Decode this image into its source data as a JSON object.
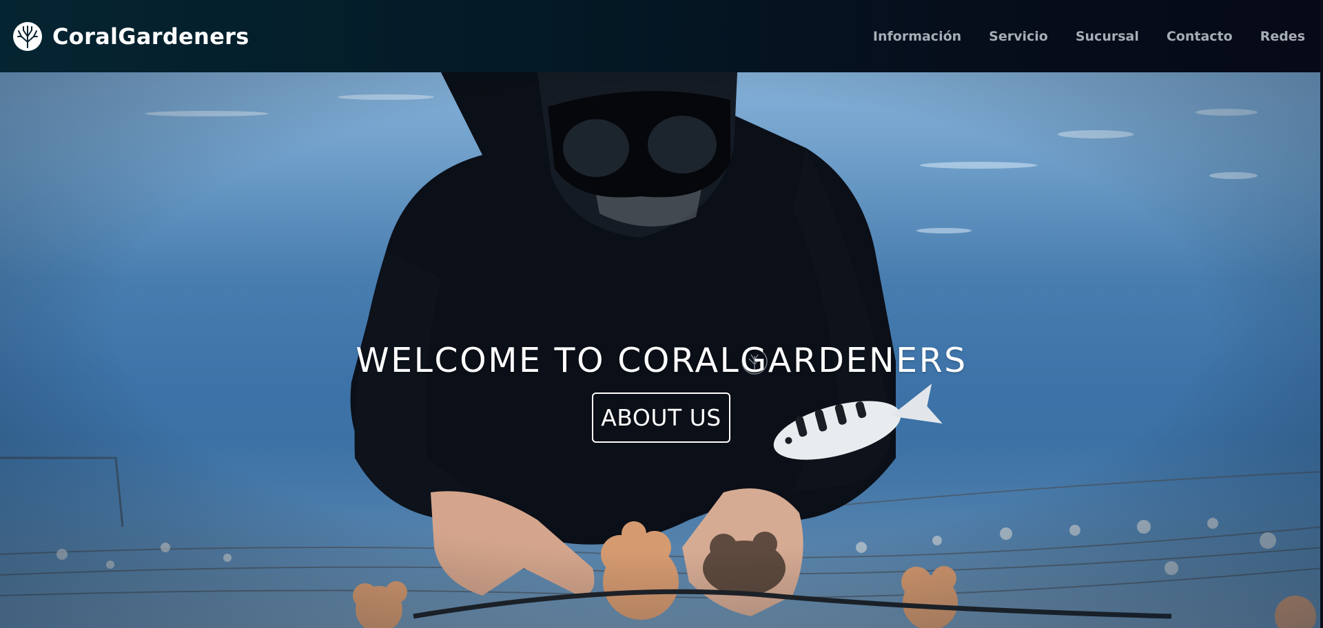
{
  "brand": {
    "name": "CoralGardeners",
    "logo_icon": "coral-icon"
  },
  "nav": {
    "items": [
      {
        "label": "Información"
      },
      {
        "label": "Servicio"
      },
      {
        "label": "Sucursal"
      },
      {
        "label": "Contacto"
      },
      {
        "label": "Redes"
      }
    ]
  },
  "hero": {
    "title": "WELCOME TO CORALGARDENERS",
    "button_label": "ABOUT US"
  },
  "colors": {
    "header_bg": "#041a26",
    "nav_text": "#a7adb5",
    "hero_water": "#3d73a8",
    "text": "#ffffff"
  }
}
